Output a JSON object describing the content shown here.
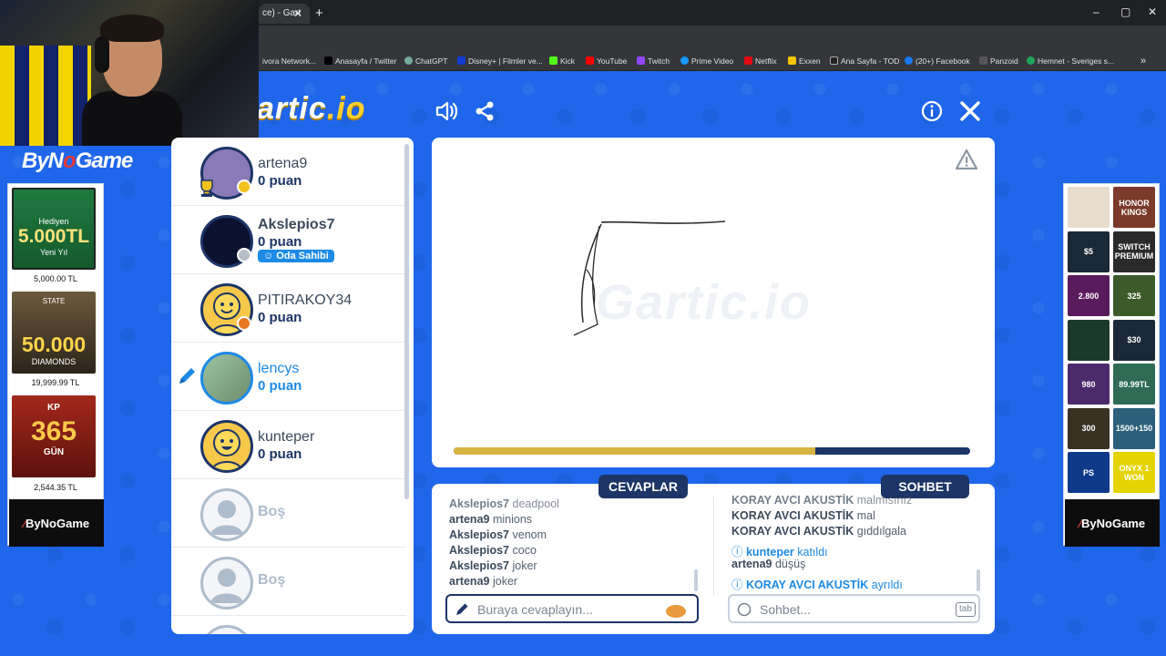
{
  "browser": {
    "tab_title": "ce) - Gart",
    "new_tab": "+",
    "bookmarks": [
      {
        "label": "ivora Network...",
        "color": "#6b7280"
      },
      {
        "label": "Anasayfa / Twitter",
        "color": "#000000"
      },
      {
        "label": "ChatGPT",
        "color": "#74aa9c"
      },
      {
        "label": "Disney+ | Filmler ve...",
        "color": "#113ccf"
      },
      {
        "label": "Kick",
        "color": "#53fc18"
      },
      {
        "label": "YouTube",
        "color": "#ff0000"
      },
      {
        "label": "Twitch",
        "color": "#9146ff"
      },
      {
        "label": "Prime Video",
        "color": "#1399ff"
      },
      {
        "label": "Netflix",
        "color": "#e50914"
      },
      {
        "label": "Exxen",
        "color": "#f5c400"
      },
      {
        "label": "Ana Sayfa - TOD",
        "color": "#444444"
      },
      {
        "label": "(20+) Facebook",
        "color": "#1877f2"
      },
      {
        "label": "Panzoid",
        "color": "#444444"
      },
      {
        "label": "Hemnet - Sveriges s...",
        "color": "#20a35a"
      }
    ],
    "more": "»"
  },
  "game": {
    "logo_left": "artic",
    "logo_right": ".io",
    "icons": {
      "sound": "speaker-icon",
      "share": "share-icon",
      "info": "info-icon",
      "close": "close-icon",
      "report": "warning-icon"
    },
    "brand_text": {
      "a": "ByN",
      "b": "Game"
    },
    "players": [
      {
        "name": "artena9",
        "score": "0 puan",
        "dot": "#f5c11e",
        "trophy": true
      },
      {
        "name": "Akslepios7",
        "score": "0 puan",
        "dot": "#b8bec7",
        "badge": "Oda Sahibi"
      },
      {
        "name": "PITIRAKOY34",
        "score": "0 puan",
        "dot": "#e87722"
      },
      {
        "name": "lencys",
        "score": "0 puan",
        "drawing": true
      },
      {
        "name": "kunteper",
        "score": "0 puan"
      },
      {
        "name": "Boş"
      },
      {
        "name": "Boş"
      }
    ],
    "progress": 0.7,
    "tabs": {
      "answers": "CEVAPLAR",
      "chat": "SOHBET"
    },
    "answers": [
      {
        "user": "Akslepios7",
        "text": "deadpool"
      },
      {
        "user": "artena9",
        "text": "minions"
      },
      {
        "user": "Akslepios7",
        "text": "venom"
      },
      {
        "user": "Akslepios7",
        "text": "coco"
      },
      {
        "user": "Akslepios7",
        "text": "joker"
      },
      {
        "user": "artena9",
        "text": "joker"
      }
    ],
    "chat": [
      {
        "user": "KORAY AVCI AKUSTİK",
        "text": "malmısınız"
      },
      {
        "user": "KORAY AVCI AKUSTİK",
        "text": "mal"
      },
      {
        "user": "KORAY AVCI AKUSTİK",
        "text": "gıddılgala"
      },
      {
        "user": "kunteper",
        "text": "katıldı",
        "system": true
      },
      {
        "user": "artena9",
        "text": "düşüş"
      },
      {
        "user": "KORAY AVCI AKUSTİK",
        "text": "ayrıldı",
        "system": true
      }
    ],
    "answer_placeholder": "Buraya cevaplayın...",
    "chat_placeholder": "Sohbet...",
    "tab_key": "tab"
  },
  "ads_left": [
    {
      "line1": "Hediyen",
      "big": "5.000TL",
      "line2": "Yeni Yıl",
      "price": "5,000.00 TL",
      "color": "#1f6b3a"
    },
    {
      "line1": "STATE",
      "big": "50.000",
      "line2": "DIAMONDS",
      "price": "19,999.99 TL",
      "color": "#4a4032"
    },
    {
      "line1": "KP",
      "big": "365",
      "line2": "GÜN",
      "price": "2,544.35 TL",
      "color": "#7a1d14"
    }
  ],
  "ads_brand": {
    "a": "By",
    "b": "NoGame"
  },
  "ads_right": [
    {
      "label": "",
      "color": "#e8dccd"
    },
    {
      "label": "HONOR KINGS",
      "color": "#7b3a2a"
    },
    {
      "label": "$5",
      "color": "#1b2838"
    },
    {
      "label": "SWITCH PREMIUM",
      "color": "#2a2a2a"
    },
    {
      "label": "2.800",
      "color": "#5a1b5c"
    },
    {
      "label": "325",
      "color": "#3b5c2a"
    },
    {
      "label": "",
      "color": "#1c3a2c"
    },
    {
      "label": "$30",
      "color": "#1b2838"
    },
    {
      "label": "980",
      "color": "#4c2a6b"
    },
    {
      "label": "89.99TL",
      "color": "#2f6b55"
    },
    {
      "label": "300",
      "color": "#3a3024"
    },
    {
      "label": "1500+150",
      "color": "#2b5f7a"
    },
    {
      "label": "PS",
      "color": "#0f3a8a"
    },
    {
      "label": "ONYX 1 WON",
      "color": "#e5d400"
    }
  ]
}
